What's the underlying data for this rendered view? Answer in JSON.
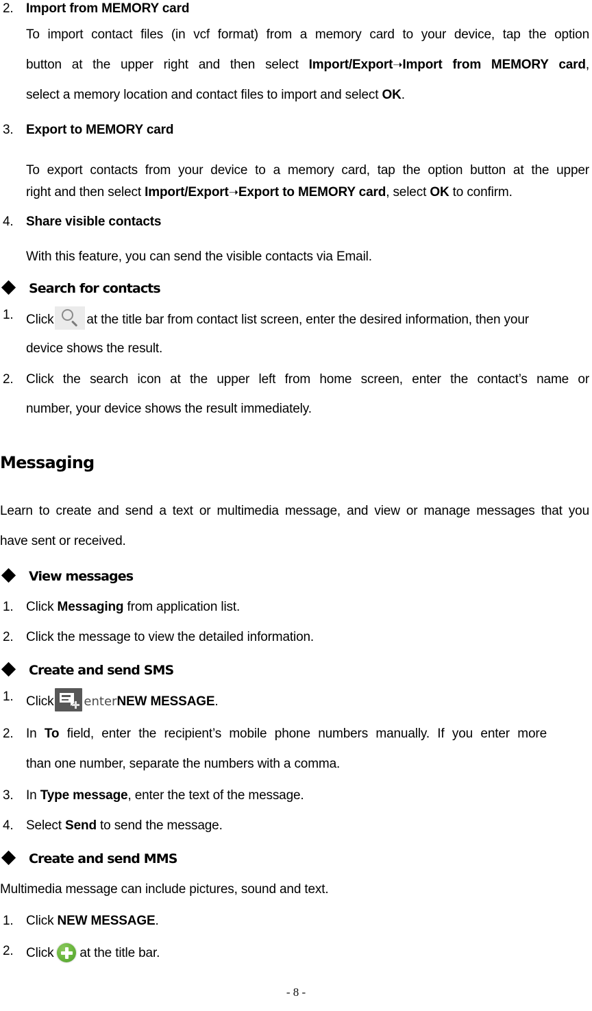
{
  "document": {
    "page_number_label": "- 8 -"
  },
  "blocks": [
    {
      "kind": "numbered-heading",
      "number": "2.",
      "text": "Import from MEMORY card"
    },
    {
      "kind": "paragraph-3line",
      "line1": "To import contact files (in vcf format) from a memory card to your device, tap the option",
      "line2_pre": "button at the upper right and then select ",
      "line2_bold_a": "Import/Export",
      "line2_arrow": "➝",
      "line2_bold_b": "Import from MEMORY card",
      "line2_post": ",",
      "line3_pre": "select a memory location and contact files to import and select ",
      "line3_bold": "OK",
      "line3_post": "."
    },
    {
      "kind": "numbered-heading",
      "number": "3.",
      "text": "Export to MEMORY card"
    },
    {
      "kind": "paragraph-2line",
      "line1": "To export contacts from your device to a memory card, tap the option button at the upper",
      "line2_pre": "right and then select ",
      "line2_bold_a": "Import/Export",
      "line2_arrow": "➝",
      "line2_bold_b": "Export to MEMORY card",
      "line2_mid": ", select ",
      "line2_bold_c": "OK",
      "line2_post": " to confirm."
    },
    {
      "kind": "numbered-heading",
      "number": "4.",
      "text": "Share visible contacts"
    },
    {
      "kind": "paragraph-1line",
      "line1": "With this feature, you can send the visible contacts via Email."
    },
    {
      "kind": "diamond-heading",
      "text": "Search for contacts"
    },
    {
      "kind": "numbered-icon-item",
      "number": "1.",
      "pre": "Click",
      "icon": "search-icon",
      "post": "at the title bar from contact list screen, enter the desired information, then your",
      "cont": "device shows the result."
    },
    {
      "kind": "numbered-item",
      "number": "2.",
      "line1": "Click the search icon at the upper left from home screen, enter the contact’s name or",
      "line2": "number, your device shows the result immediately."
    },
    {
      "kind": "section-heading",
      "text": "Messaging"
    },
    {
      "kind": "paragraph-2line",
      "line1": "Learn to create and send a text or multimedia message, and view or manage messages that you",
      "line2_pre": "have sent or received."
    },
    {
      "kind": "diamond-heading",
      "text": "View messages"
    },
    {
      "kind": "numbered-item",
      "number": "1.",
      "pre": "Click ",
      "bold": "Messaging",
      "post": " from application list."
    },
    {
      "kind": "numbered-item",
      "number": "2.",
      "line1": "Click the message to view the detailed information."
    },
    {
      "kind": "diamond-heading",
      "text": "Create and send SMS"
    },
    {
      "kind": "numbered-icon-item",
      "number": "1.",
      "pre": "Click",
      "icon": "new-message-icon",
      "mid": "enter",
      "bold": "NEW MESSAGE",
      "post": "."
    },
    {
      "kind": "numbered-item",
      "number": "2.",
      "pre": "In ",
      "bold": "To",
      "post": " field, enter the recipient’s mobile phone numbers manually. If you enter more",
      "cont": "than one number, separate the numbers with a comma."
    },
    {
      "kind": "numbered-item",
      "number": "3.",
      "pre": "In ",
      "bold": "Type message",
      "post": ", enter the text of the message."
    },
    {
      "kind": "numbered-item",
      "number": "4.",
      "pre": "Select ",
      "bold": "Send",
      "post": " to send the message."
    },
    {
      "kind": "diamond-heading",
      "text": "Create and send MMS"
    },
    {
      "kind": "paragraph-1line",
      "line1": "Multimedia message can include pictures, sound and text."
    },
    {
      "kind": "numbered-item",
      "number": "1.",
      "pre": "Click ",
      "bold": "NEW MESSAGE",
      "post": "."
    },
    {
      "kind": "numbered-icon-item",
      "number": "2.",
      "pre": "Click",
      "icon": "green-plus-icon",
      "post": "at the title bar."
    }
  ],
  "text": {
    "b0_num": "2.",
    "b0_head": "Import from MEMORY card",
    "b1_l1": "To import contact files (in vcf format) from a memory card to your device, tap the option",
    "b1_l2a": "button at the upper right and then select ",
    "b1_l2b": "Import/Export",
    "b1_arrow": "➝",
    "b1_l2c": "Import from MEMORY card",
    "b1_l2d": ",",
    "b1_l3a": "select a memory location and contact files to import and select ",
    "b1_l3b": "OK",
    "b1_l3c": ".",
    "b2_num": "3.",
    "b2_head": "Export to MEMORY card",
    "b3_l1": "To export contacts from your device to a memory card, tap the option button at the upper",
    "b3_l2a": "right and then select ",
    "b3_l2b": "Import/Export",
    "b3_arrow": "➝",
    "b3_l2c": "Export to MEMORY card",
    "b3_l2d": ", select ",
    "b3_l2e": "OK",
    "b3_l2f": " to confirm.",
    "b4_num": "4.",
    "b4_head": "Share visible contacts",
    "b5_l1": "With this feature, you can send the visible contacts via Email.",
    "b6_head": "Search for contacts",
    "b7_num": "1.",
    "b7_pre": "Click",
    "b7_post": "at the title bar from contact list screen, enter the desired information, then your",
    "b7_cont": "device shows the result.",
    "b8_num": "2.",
    "b8_l1": "Click the search icon at the upper left from home screen, enter the contact’s name or",
    "b8_l2": "number, your device shows the result immediately.",
    "b9_head": "Messaging",
    "b10_l1": "Learn to create and send a text or multimedia message, and view or manage messages that you",
    "b10_l2": "have sent or received.",
    "b11_head": "View messages",
    "b12_num": "1.",
    "b12_pre": "Click ",
    "b12_bold": "Messaging",
    "b12_post": " from application list.",
    "b13_num": "2.",
    "b13_l1": "Click the message to view the detailed information.",
    "b14_head": "Create and send SMS",
    "b15_num": "1.",
    "b15_pre": "Click",
    "b15_mid": "enter",
    "b15_bold": "NEW MESSAGE",
    "b15_post": ".",
    "b16_num": "2.",
    "b16_pre": "In ",
    "b16_bold": "To",
    "b16_post": " field, enter the recipient’s mobile phone numbers manually. If you enter more",
    "b16_cont": "than one number, separate the numbers with a comma.",
    "b17_num": "3.",
    "b17_pre": "In ",
    "b17_bold": "Type message",
    "b17_post": ", enter the text of the message.",
    "b18_num": "4.",
    "b18_pre": "Select ",
    "b18_bold": "Send",
    "b18_post": " to send the message.",
    "b19_head": "Create and send MMS",
    "b20_l1": "Multimedia message can include pictures, sound and text.",
    "b21_num": "1.",
    "b21_pre": "Click ",
    "b21_bold": "NEW MESSAGE",
    "b21_post": ".",
    "b22_num": "2.",
    "b22_pre": "Click",
    "b22_post": "at the title bar.",
    "footer": "- 8 -"
  },
  "colors": {
    "text": "#000000",
    "search_icon_bg": "#ebebeb",
    "search_icon_glyph": "#8a8a8a",
    "new_message_icon_bg": "#575757",
    "new_message_icon_glyph": "#ffffff",
    "green_plus": "#6cb83f",
    "green_plus_glyph": "#ffffff"
  },
  "icons": {
    "search": "search-icon",
    "new_message": "new-message-icon",
    "green_plus": "green-plus-icon"
  }
}
